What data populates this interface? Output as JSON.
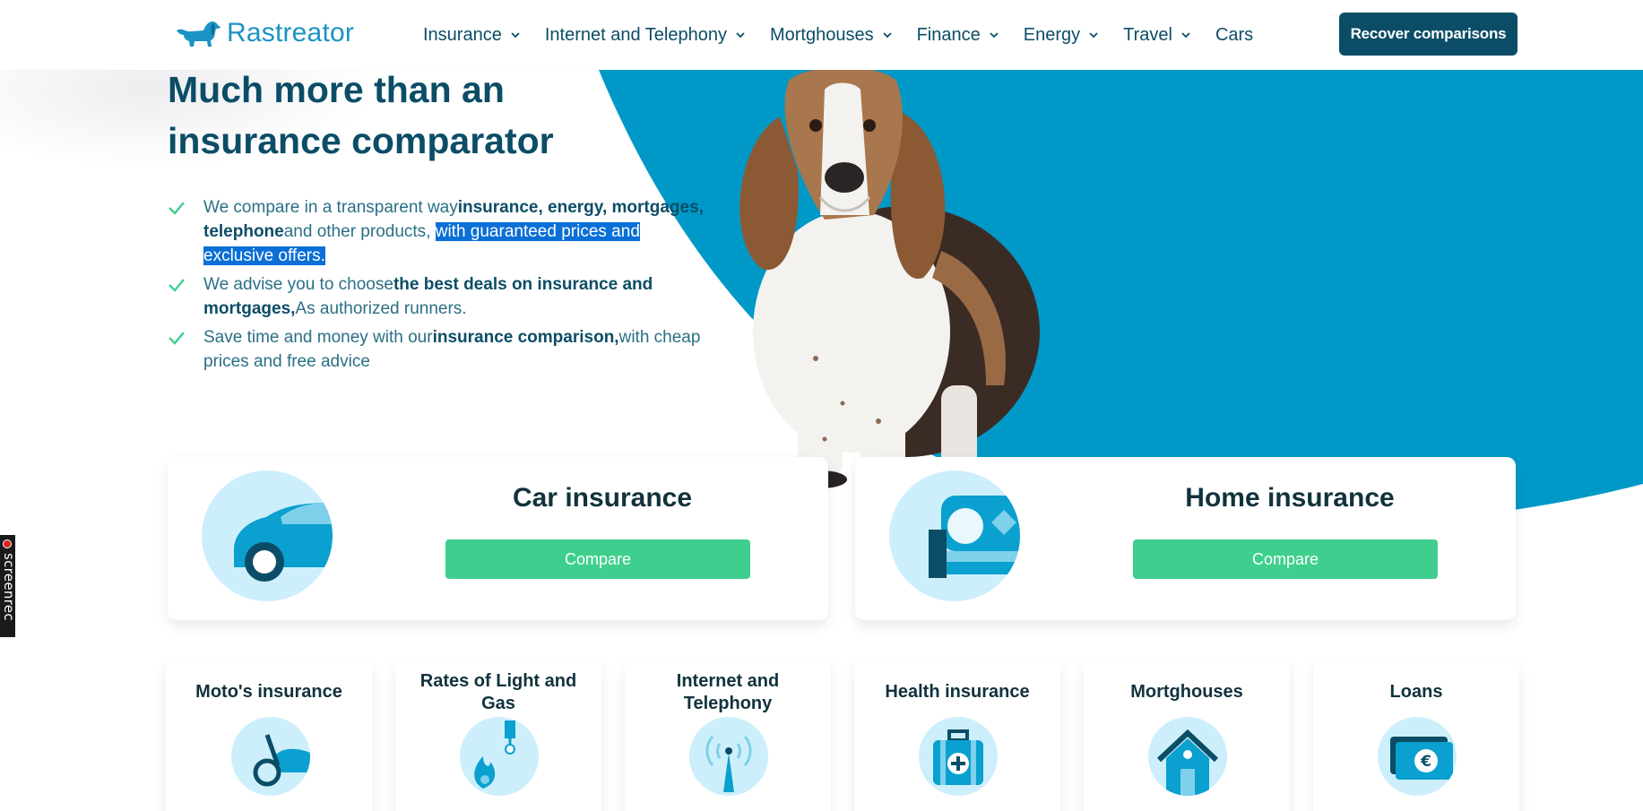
{
  "brand": {
    "name": "Rastreator"
  },
  "nav": {
    "items": [
      {
        "label": "Insurance",
        "dropdown": true
      },
      {
        "label": "Internet and Telephony",
        "dropdown": true
      },
      {
        "label": "Mortghouses",
        "dropdown": true
      },
      {
        "label": "Finance",
        "dropdown": true
      },
      {
        "label": "Energy",
        "dropdown": true
      },
      {
        "label": "Travel",
        "dropdown": true
      },
      {
        "label": "Cars",
        "dropdown": false
      }
    ],
    "cta_label": "Recover comparisons"
  },
  "hero": {
    "title": "Much more than an insurance comparator",
    "features": [
      {
        "t1": "We compare in a transparent way",
        "b1": "insurance, energy, mortgages, telephone",
        "t2": "and other products, ",
        "highlight": "with guaranteed prices and exclusive offers",
        "t3": "."
      },
      {
        "t1": "We advise you to choose",
        "b1": "the best deals on insurance and mortgages,",
        "t2": "As authorized runners."
      },
      {
        "t1": "Save time and money with our",
        "b1": "insurance comparison,",
        "t2": "with cheap prices and free advice"
      }
    ]
  },
  "cards": {
    "main": [
      {
        "title": "Car insurance",
        "button": "Compare",
        "icon": "car-icon"
      },
      {
        "title": "Home insurance",
        "button": "Compare",
        "icon": "home-icon"
      }
    ],
    "secondary": [
      {
        "title": "Moto's insurance",
        "icon": "moto-icon"
      },
      {
        "title": "Rates of Light and Gas",
        "icon": "gas-flame-icon"
      },
      {
        "title": "Internet and Telephony",
        "icon": "antenna-icon"
      },
      {
        "title": "Health insurance",
        "icon": "medical-kit-icon"
      },
      {
        "title": "Mortghouses",
        "icon": "house-icon"
      },
      {
        "title": "Loans",
        "icon": "euro-note-icon"
      }
    ]
  },
  "overlay": {
    "screenrec_label": "screenrec"
  },
  "colors": {
    "primary_dark": "#0b4d66",
    "brand_blue": "#1b93c5",
    "hero_blue": "#0098c7",
    "compare_green": "#3ecf8e",
    "icon_bg": "#cdeffb",
    "highlight": "#0a6fd6"
  }
}
